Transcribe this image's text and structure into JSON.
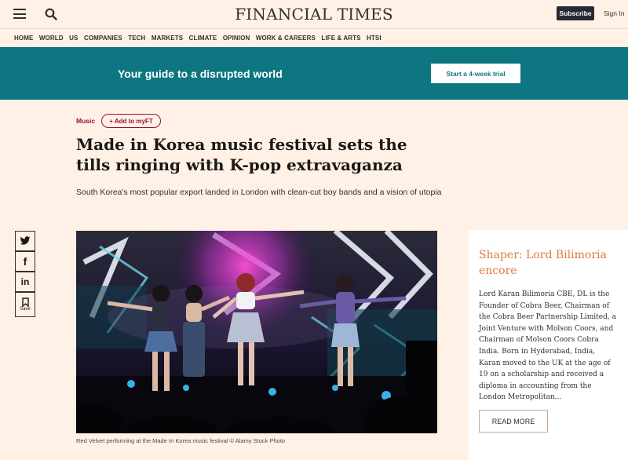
{
  "header": {
    "logo": "FINANCIAL TIMES",
    "subscribe_label": "Subscribe",
    "signin_label": "Sign In"
  },
  "nav": {
    "items": [
      "HOME",
      "WORLD",
      "US",
      "COMPANIES",
      "TECH",
      "MARKETS",
      "CLIMATE",
      "OPINION",
      "WORK & CAREERS",
      "LIFE & ARTS",
      "HTSI"
    ]
  },
  "banner": {
    "text": "Your guide to a disrupted world",
    "cta": "Start a 4-week trial",
    "color": "#0D7680"
  },
  "article": {
    "topic": "Music",
    "add_myft": "+ Add to myFT",
    "headline": "Made in Korea music festival sets the tills ringing with K-pop extravaganza",
    "standfirst": "South Korea's most popular export landed in London with clean-cut boy bands and a vision of utopia",
    "caption": "Red Velvet performing at the Made In Korea music festival © Alamy Stock Photo"
  },
  "share": {
    "twitter": "twitter-icon",
    "facebook": "facebook-icon",
    "linkedin": "linkedin-icon",
    "save_label": "Save"
  },
  "sidebar": {
    "title": "Shaper: Lord Bilimoria encore",
    "body": "Lord Karan Bilimoria CBE, DL is the Founder of Cobra Beer, Chairman of the Cobra Beer Partnership Limited, a Joint Venture with Molson Coors, and Chairman of Molson Coors Cobra India. Born in Hyderabad, India, Karan moved to the UK at the age of 19 on a scholarship and received a diploma in accounting from the London Metropolitan...",
    "readmore": "READ MORE"
  },
  "colors": {
    "background": "#FFF1E5",
    "accent": "#990F3D",
    "sidebar_title": "#E07A3A"
  }
}
